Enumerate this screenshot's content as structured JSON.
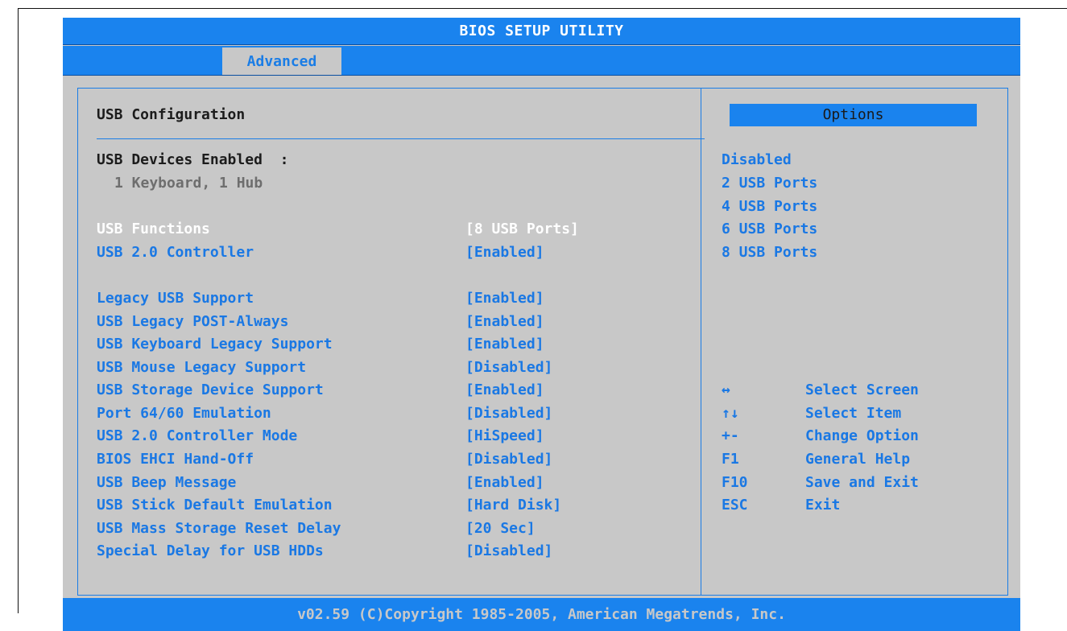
{
  "title": "BIOS SETUP UTILITY",
  "tab": "Advanced",
  "section_title": "USB Configuration",
  "devices": {
    "label": "USB Devices Enabled  :",
    "value": "1 Keyboard, 1 Hub"
  },
  "settings": [
    {
      "label": "USB Functions",
      "value": "[8 USB Ports]"
    },
    {
      "label": "USB 2.0 Controller",
      "value": "[Enabled]"
    },
    {
      "label": "Legacy USB Support",
      "value": "[Enabled]"
    },
    {
      "label": "USB Legacy POST-Always",
      "value": "[Enabled]"
    },
    {
      "label": "USB Keyboard Legacy Support",
      "value": "[Enabled]"
    },
    {
      "label": "USB Mouse Legacy Support",
      "value": "[Disabled]"
    },
    {
      "label": "USB Storage Device Support",
      "value": "[Enabled]"
    },
    {
      "label": "Port 64/60 Emulation",
      "value": "[Disabled]"
    },
    {
      "label": "USB 2.0 Controller Mode",
      "value": "[HiSpeed]"
    },
    {
      "label": "BIOS EHCI Hand-Off",
      "value": "[Disabled]"
    },
    {
      "label": "USB Beep Message",
      "value": "[Enabled]"
    },
    {
      "label": "USB Stick Default Emulation",
      "value": "[Hard Disk]"
    },
    {
      "label": "USB Mass Storage Reset Delay",
      "value": "[20 Sec]"
    },
    {
      "label": "Special Delay for USB HDDs",
      "value": "[Disabled]"
    }
  ],
  "options": {
    "header": "Options",
    "items": [
      "Disabled",
      "2 USB Ports",
      "4 USB Ports",
      "6 USB Ports",
      "8 USB Ports"
    ]
  },
  "help": [
    {
      "key": "↔",
      "action": "Select Screen"
    },
    {
      "key": "↑↓",
      "action": "Select Item"
    },
    {
      "key": "+-",
      "action": "Change Option"
    },
    {
      "key": "F1",
      "action": "General Help"
    },
    {
      "key": "F10",
      "action": "Save and Exit"
    },
    {
      "key": "ESC",
      "action": "Exit"
    }
  ],
  "footer": "v02.59 (C)Copyright 1985-2005, American Megatrends, Inc."
}
